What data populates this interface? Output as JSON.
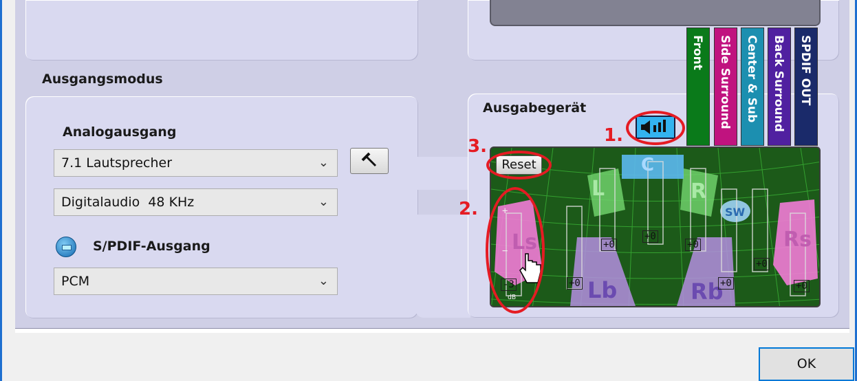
{
  "sections": {
    "ausgangsmodus": {
      "title": "Ausgangsmodus",
      "analog_title": "Analogausgang",
      "speaker_select": "7.1 Lautsprecher",
      "digital_select": "Digitalaudio  48 KHz",
      "spdif_title": "S/PDIF-Ausgang",
      "spdif_select": "PCM"
    },
    "ausgabegeraet": {
      "title": "Ausgabegerät",
      "reset_label": "Reset"
    }
  },
  "tabs": [
    {
      "label": "Front",
      "color": "#0a7a1a"
    },
    {
      "label": "Side Surround",
      "color": "#c0137f"
    },
    {
      "label": "Center & Sub",
      "color": "#1c8fb0"
    },
    {
      "label": "Back Surround",
      "color": "#5020a0"
    },
    {
      "label": "SPDIF OUT",
      "color": "#1a2a6a"
    }
  ],
  "annotations": [
    "1.",
    "2.",
    "3."
  ],
  "mixer": {
    "speakers": [
      "L",
      "C",
      "R",
      "SW",
      "Ls",
      "Rs",
      "Lb",
      "Rb"
    ],
    "values": [
      "+0",
      "+0",
      "+0",
      "+0",
      "-3",
      "+0",
      "+0",
      "+0"
    ],
    "unit": "dB",
    "plus": "+",
    "minus": "−"
  },
  "dialog": {
    "ok_label": "OK"
  },
  "colors": {
    "annotation_red": "#e51b23",
    "accent_blue": "#0078d7"
  }
}
